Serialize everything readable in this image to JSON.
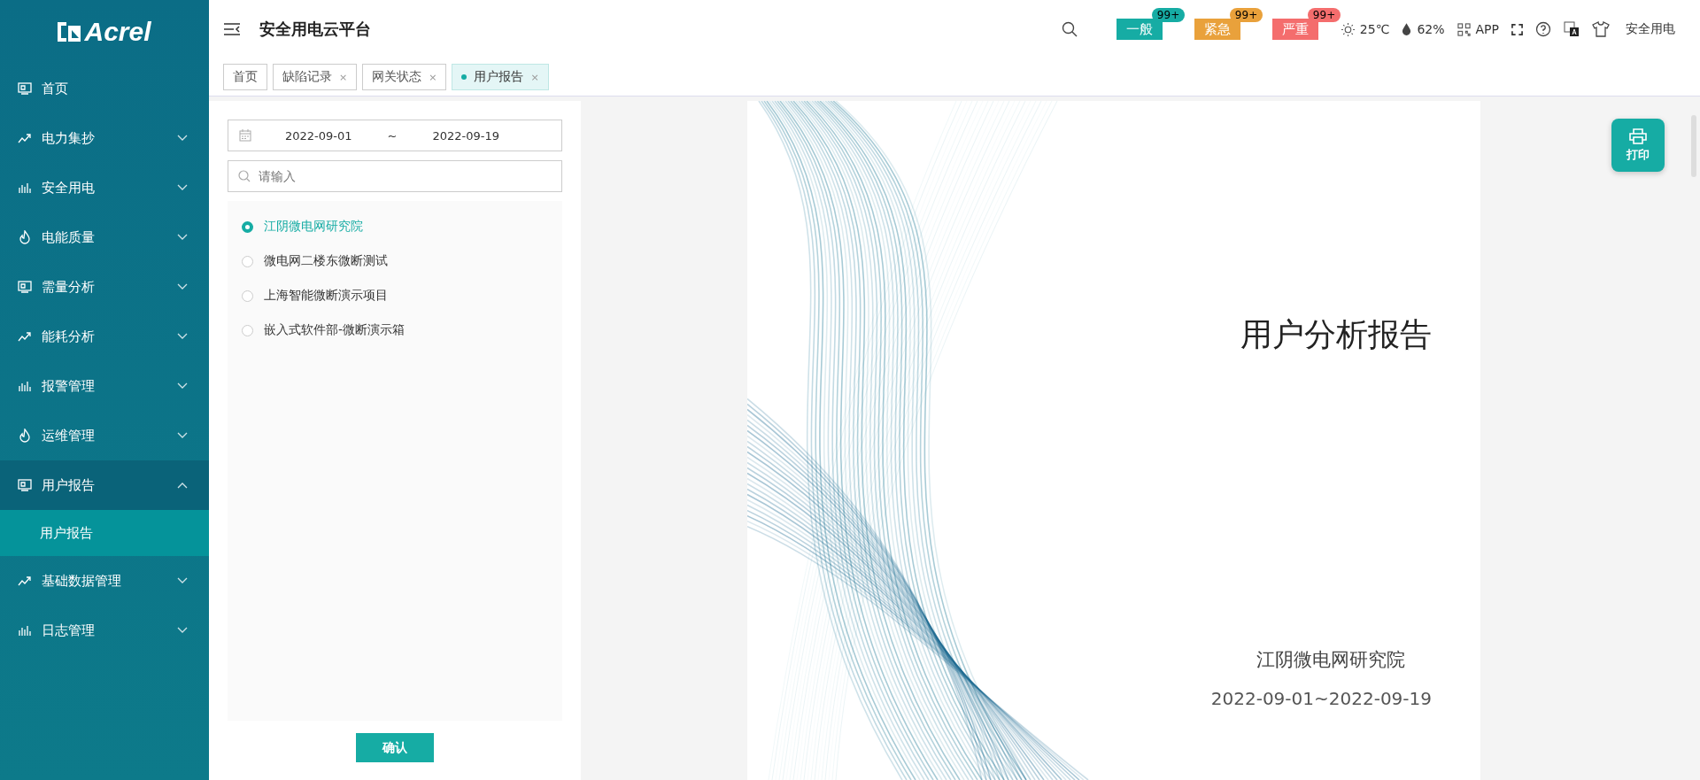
{
  "sidebar": {
    "logo": "Acrel",
    "items": [
      {
        "label": "首页"
      },
      {
        "label": "电力集抄",
        "expanded": false
      },
      {
        "label": "安全用电",
        "expanded": false
      },
      {
        "label": "电能质量",
        "expanded": false
      },
      {
        "label": "需量分析",
        "expanded": false
      },
      {
        "label": "能耗分析",
        "expanded": false
      },
      {
        "label": "报警管理",
        "expanded": false
      },
      {
        "label": "运维管理",
        "expanded": false
      },
      {
        "label": "用户报告",
        "expanded": true,
        "children": [
          {
            "label": "用户报告",
            "selected": true
          }
        ]
      },
      {
        "label": "基础数据管理",
        "expanded": false
      },
      {
        "label": "日志管理",
        "expanded": false
      }
    ]
  },
  "header": {
    "title": "安全用电云平台",
    "alerts": [
      {
        "label": "一般",
        "count": "99+",
        "color": "#16aca4"
      },
      {
        "label": "紧急",
        "count": "99+",
        "color": "#e9a13b"
      },
      {
        "label": "严重",
        "count": "99+",
        "color": "#f46d6d"
      }
    ],
    "temperature": "25℃",
    "humidity": "62%",
    "app": "APP",
    "user": "安全用电"
  },
  "tabs": [
    {
      "label": "首页",
      "selected": false
    },
    {
      "label": "缺陷记录",
      "selected": false,
      "close": "×"
    },
    {
      "label": "网关状态",
      "selected": false,
      "close": "×"
    },
    {
      "label": "用户报告",
      "selected": true,
      "close": "×"
    }
  ],
  "filter": {
    "date_start": "2022-09-01",
    "date_separator": "~",
    "date_end": "2022-09-19",
    "search": {
      "placeholder": "请输入"
    },
    "projects": [
      {
        "label": "江阴微电网研究院",
        "selected": true
      },
      {
        "label": "微电网二楼东微断测试",
        "selected": false
      },
      {
        "label": "上海智能微断演示项目",
        "selected": false
      },
      {
        "label": "嵌入式软件部-微断演示箱",
        "selected": false
      }
    ],
    "confirm": "确认"
  },
  "report": {
    "title": "用户分析报告",
    "organization": "江阴微电网研究院",
    "period": "2022-09-01~2022-09-19"
  },
  "print": "打印"
}
